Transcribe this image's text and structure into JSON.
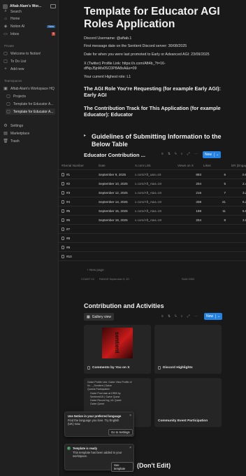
{
  "sidebar": {
    "workspace_name": "Aftab Alam's Wor...",
    "top_items": [
      {
        "label": "Search",
        "icon": "search-icon"
      },
      {
        "label": "Home",
        "icon": "home-icon"
      },
      {
        "label": "Notion AI",
        "icon": "ai-icon",
        "badge": "New"
      },
      {
        "label": "Inbox",
        "icon": "inbox-icon",
        "badge": "1"
      }
    ],
    "private_label": "Private",
    "private_items": [
      {
        "label": "Welcome to Notion!"
      },
      {
        "label": "To Do List"
      },
      {
        "label": "Add new"
      }
    ],
    "teamspaces_label": "Teamspaces",
    "team_items": [
      {
        "label": "Aftab Alam's Workspace HQ"
      },
      {
        "label": "Projects"
      },
      {
        "label": "Template for Educator A..."
      },
      {
        "label": "Template for Educator A..."
      }
    ],
    "bottom_items": [
      {
        "label": "Settings"
      },
      {
        "label": "Marketplace"
      },
      {
        "label": "Trash"
      }
    ]
  },
  "page": {
    "title": "Template for Educator AGI Roles Application",
    "discord_username": "Discord Username: @aftab.1",
    "first_message": "First message date on the Sentient Discord server: 30/08/2025",
    "promoted_date": "Date for when you were last promoted to Early or Advanced AGI: 23/09/2025",
    "twitter_line1": "X (Twitter) Profile Link: https://x.com/Aft4b_?t=16-",
    "twitter_line2": "dfNpJ5jnMs0SC0P8A8sA&s=09",
    "highest_role": "Your current Highest role: L1",
    "role_heading": "The AGI Role You're Requesting (for example Early AGI): Early AGI",
    "track_heading": "The Contribution Track for This Application (for example Educator): Educator",
    "guidelines_heading": "Guidelines of Submitting Information to the Below Table",
    "db_title": "Educator Contribution ...",
    "new_label": "New",
    "columns": [
      "#Serial Number",
      "Date",
      "X.com Link",
      "Views on X",
      "Likes",
      "ER (Engag"
    ],
    "rows": [
      {
        "num": "#1",
        "date": "September 9, 2025",
        "link": "x.com/Aft_u&s=19",
        "views": "893",
        "likes": "6",
        "er": "0.6958"
      },
      {
        "num": "#2",
        "date": "September 10, 2025",
        "link": "x.com/Aft_A&s=19",
        "views": "204",
        "likes": "5",
        "er": "2.4509"
      },
      {
        "num": "#3",
        "date": "September 12, 2025",
        "link": "x.com/Aft_A&s=19",
        "views": "216",
        "likes": "7",
        "er": "3.2407"
      },
      {
        "num": "#4",
        "date": "September 14, 2025",
        "link": "x.com/Aft_A&s=19",
        "views": "338",
        "likes": "21",
        "er": "6.2130"
      },
      {
        "num": "#5",
        "date": "September 15, 2025",
        "link": "x.com/Aft_A&s=19",
        "views": "198",
        "likes": "11",
        "er": "5.5555"
      },
      {
        "num": "#6",
        "date": "September 18, 2025",
        "link": "x.com/Aft_A&s=19",
        "views": "204",
        "likes": "8",
        "er": "3.9215"
      },
      {
        "num": "#7",
        "date": "",
        "link": "",
        "views": "",
        "likes": "",
        "er": ""
      },
      {
        "num": "#8",
        "date": "",
        "link": "",
        "views": "",
        "likes": "",
        "er": ""
      },
      {
        "num": "#9",
        "date": "",
        "link": "",
        "views": "",
        "likes": "",
        "er": ""
      },
      {
        "num": "#10",
        "date": "",
        "link": "",
        "views": "",
        "likes": "",
        "er": ""
      }
    ],
    "new_page_label": "New page",
    "footer_count": "COUNT 10",
    "footer_range": "RANGE September 9, 20",
    "footer_sum": "SUM 2053",
    "activities_heading": "Contribution and Activities",
    "gallery_view_label": "Gallery view",
    "gallery_new_label": "New",
    "cards": [
      {
        "title": "Comments by You on X",
        "image_text": "sentient"
      },
      {
        "title": "Discord Highlights"
      },
      {
        "title": "",
        "lines": [
          "Galxe Profile Link: Galxe View Profile of",
          "0x…_Sentient | Galxe",
          "Quests Participated:",
          "Galxe Post task at DRIB by",
          "SentientAGI | Galxe Quest",
          "Galxe Record bg | #1 Quest",
          "Galxe Quest"
        ]
      },
      {
        "title": "Community Event Participation"
      }
    ],
    "dont_edit": "(Don't Edit)"
  },
  "toast1": {
    "title": "Use Notion in your preferred language",
    "body": "Find the language you love. Try English (UK) now.",
    "button": "Go to Settings"
  },
  "toast2": {
    "title": "Template is ready",
    "body": "This template has been added to your workspace.",
    "button": "See template"
  }
}
